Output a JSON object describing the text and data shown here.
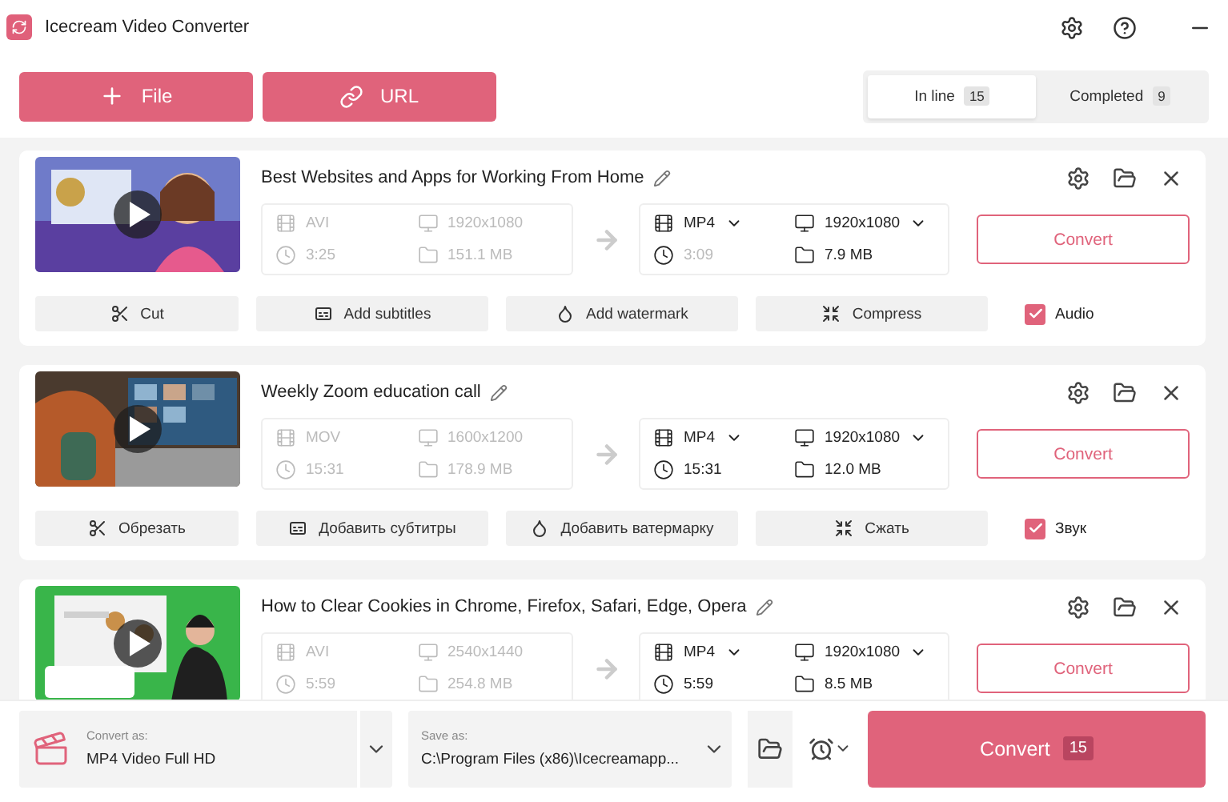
{
  "window": {
    "title": "Icecream Video Converter"
  },
  "toolbar": {
    "buttons": [
      {
        "kind": "file",
        "label": "File"
      },
      {
        "kind": "url",
        "label": "URL"
      }
    ]
  },
  "tabs": [
    {
      "label": "In line",
      "count": "15",
      "selected": true
    },
    {
      "label": "Completed",
      "count": "9",
      "selected": false
    }
  ],
  "cards": [
    {
      "title": "Best Websites and Apps for Working From Home",
      "source": {
        "format": "AVI",
        "resolution": "1920x1080",
        "duration": "3:25",
        "size": "151.1 MB"
      },
      "target": {
        "format": "MP4",
        "resolution": "1920x1080",
        "duration": "3:09",
        "duration_disabled": true,
        "size": "7.9 MB"
      },
      "convert": "Convert",
      "actions": [
        {
          "kind": "cut",
          "label": "Cut"
        },
        {
          "kind": "subtitles",
          "label": "Add subtitles"
        },
        {
          "kind": "watermark",
          "label": "Add watermark"
        },
        {
          "kind": "compress",
          "label": "Compress"
        }
      ],
      "audio": {
        "label": "Audio",
        "checked": true
      }
    },
    {
      "title": "Weekly Zoom education call",
      "source": {
        "format": "MOV",
        "resolution": "1600x1200",
        "duration": "15:31",
        "size": "178.9 MB"
      },
      "target": {
        "format": "MP4",
        "resolution": "1920x1080",
        "duration": "15:31",
        "duration_disabled": false,
        "size": "12.0 MB"
      },
      "convert": "Convert",
      "actions": [
        {
          "kind": "cut",
          "label": "Обрезать"
        },
        {
          "kind": "subtitles",
          "label": "Добавить субтитры"
        },
        {
          "kind": "watermark",
          "label": "Добавить ватермарку"
        },
        {
          "kind": "compress",
          "label": "Сжать"
        }
      ],
      "audio": {
        "label": "Звук",
        "checked": true
      }
    },
    {
      "title": "How to Clear Cookies in Chrome, Firefox, Safari, Edge, Opera",
      "source": {
        "format": "AVI",
        "resolution": "2540x1440",
        "duration": "5:59",
        "size": "254.8 MB"
      },
      "target": {
        "format": "MP4",
        "resolution": "1920x1080",
        "duration": "5:59",
        "duration_disabled": false,
        "size": "8.5 MB"
      },
      "convert": "Convert"
    }
  ],
  "footer": {
    "convert_as": {
      "label": "Convert as:",
      "value": "MP4 Video Full HD"
    },
    "save_as": {
      "label": "Save as:",
      "value": "C:\\Program Files (x86)\\Icecreamapp..."
    },
    "convert": {
      "label": "Convert",
      "count": "15"
    }
  }
}
